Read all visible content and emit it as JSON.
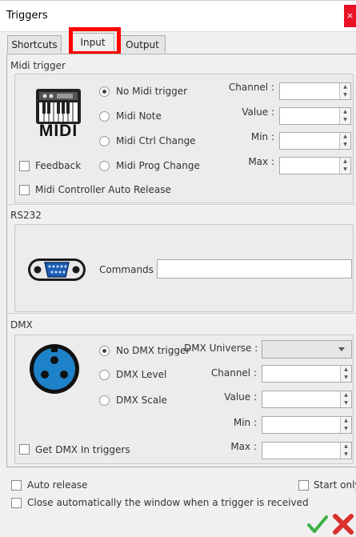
{
  "window": {
    "title": "Triggers",
    "close_glyph": "×"
  },
  "tabs": [
    {
      "label": "Shortcuts",
      "active": false
    },
    {
      "label": "Input",
      "active": true
    },
    {
      "label": "Output",
      "active": false
    }
  ],
  "midi": {
    "section_label": "Midi trigger",
    "icon_text": "MIDI",
    "radios": [
      {
        "label": "No Midi trigger",
        "checked": true
      },
      {
        "label": "Midi Note",
        "checked": false
      },
      {
        "label": "Midi Ctrl Change",
        "checked": false
      },
      {
        "label": "Midi Prog Change",
        "checked": false
      }
    ],
    "fields": [
      {
        "label": "Channel :",
        "value": ""
      },
      {
        "label": "Value :",
        "value": ""
      },
      {
        "label": "Min :",
        "value": ""
      },
      {
        "label": "Max :",
        "value": ""
      }
    ],
    "feedback_label": "Feedback",
    "auto_release_label": "Midi Controller Auto Release"
  },
  "rs232": {
    "section_label": "RS232",
    "commands_label": "Commands :",
    "commands_value": ""
  },
  "dmx": {
    "section_label": "DMX",
    "radios": [
      {
        "label": "No DMX trigger",
        "checked": true
      },
      {
        "label": "DMX Level",
        "checked": false
      },
      {
        "label": "DMX Scale",
        "checked": false
      }
    ],
    "universe_label": "DMX Universe :",
    "universe_value": "",
    "fields": [
      {
        "label": "Channel :",
        "value": ""
      },
      {
        "label": "Value :",
        "value": ""
      },
      {
        "label": "Min :",
        "value": ""
      },
      {
        "label": "Max :",
        "value": ""
      }
    ],
    "get_dmx_label": "Get DMX In triggers"
  },
  "footer": {
    "auto_release_label": "Auto release",
    "close_auto_label": "Close automatically the window when a trigger is received",
    "start_only_label": "Start only"
  },
  "colors": {
    "accent_highlight": "#ff0000",
    "ok_green": "#3cb043",
    "cancel_red": "#d9302c",
    "dmx_connector_blue": "#1e82c8"
  }
}
